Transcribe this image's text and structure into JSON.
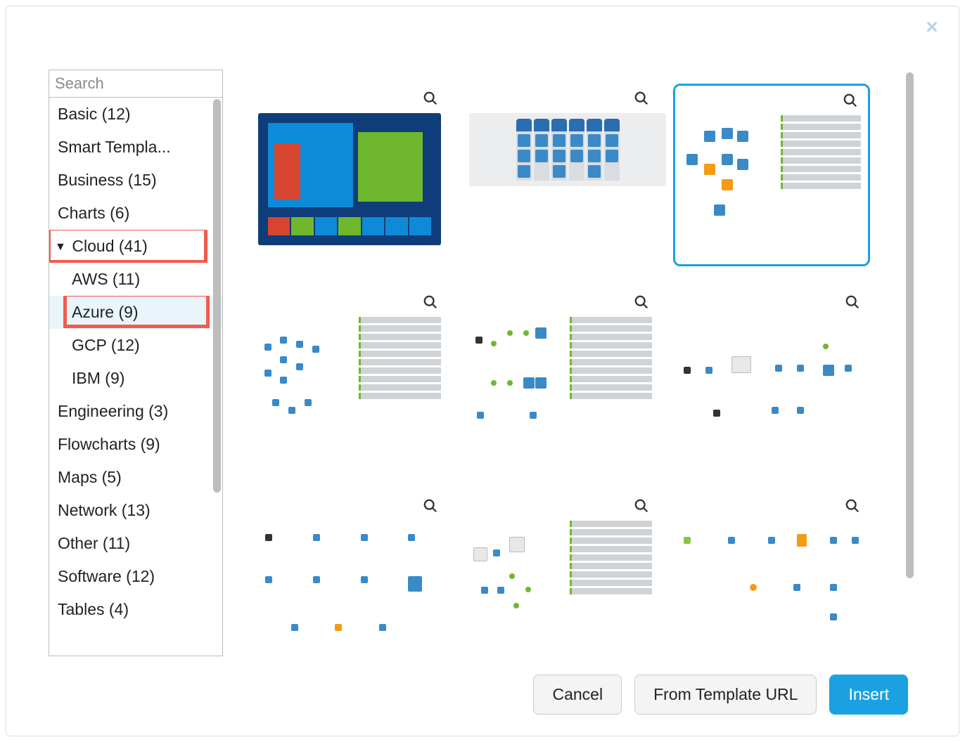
{
  "close_label": "×",
  "search": {
    "placeholder": "Search"
  },
  "categories": [
    {
      "label": "Basic (12)",
      "level": 0
    },
    {
      "label": "Smart Templa...",
      "level": 0
    },
    {
      "label": "Business (15)",
      "level": 0
    },
    {
      "label": "Charts (6)",
      "level": 0
    },
    {
      "label": "Cloud (41)",
      "level": 0,
      "expanded": true,
      "highlight": true
    },
    {
      "label": "AWS (11)",
      "level": 1
    },
    {
      "label": "Azure (9)",
      "level": 1,
      "selected": true,
      "highlight": true
    },
    {
      "label": "GCP (12)",
      "level": 1
    },
    {
      "label": "IBM (9)",
      "level": 1
    },
    {
      "label": "Engineering (3)",
      "level": 0
    },
    {
      "label": "Flowcharts (9)",
      "level": 0
    },
    {
      "label": "Maps (5)",
      "level": 0
    },
    {
      "label": "Network (13)",
      "level": 0
    },
    {
      "label": "Other (11)",
      "level": 0
    },
    {
      "label": "Software (12)",
      "level": 0
    },
    {
      "label": "Tables (4)",
      "level": 0
    }
  ],
  "tree_arrow": "▼",
  "templates": [
    {
      "id": "azure-1",
      "selected": false
    },
    {
      "id": "azure-2",
      "selected": false
    },
    {
      "id": "azure-3",
      "selected": true
    },
    {
      "id": "azure-4",
      "selected": false
    },
    {
      "id": "azure-5",
      "selected": false
    },
    {
      "id": "azure-6",
      "selected": false
    },
    {
      "id": "azure-7",
      "selected": false
    },
    {
      "id": "azure-8",
      "selected": false
    },
    {
      "id": "azure-9",
      "selected": false
    }
  ],
  "footer": {
    "cancel": "Cancel",
    "from_url": "From Template URL",
    "insert": "Insert"
  }
}
